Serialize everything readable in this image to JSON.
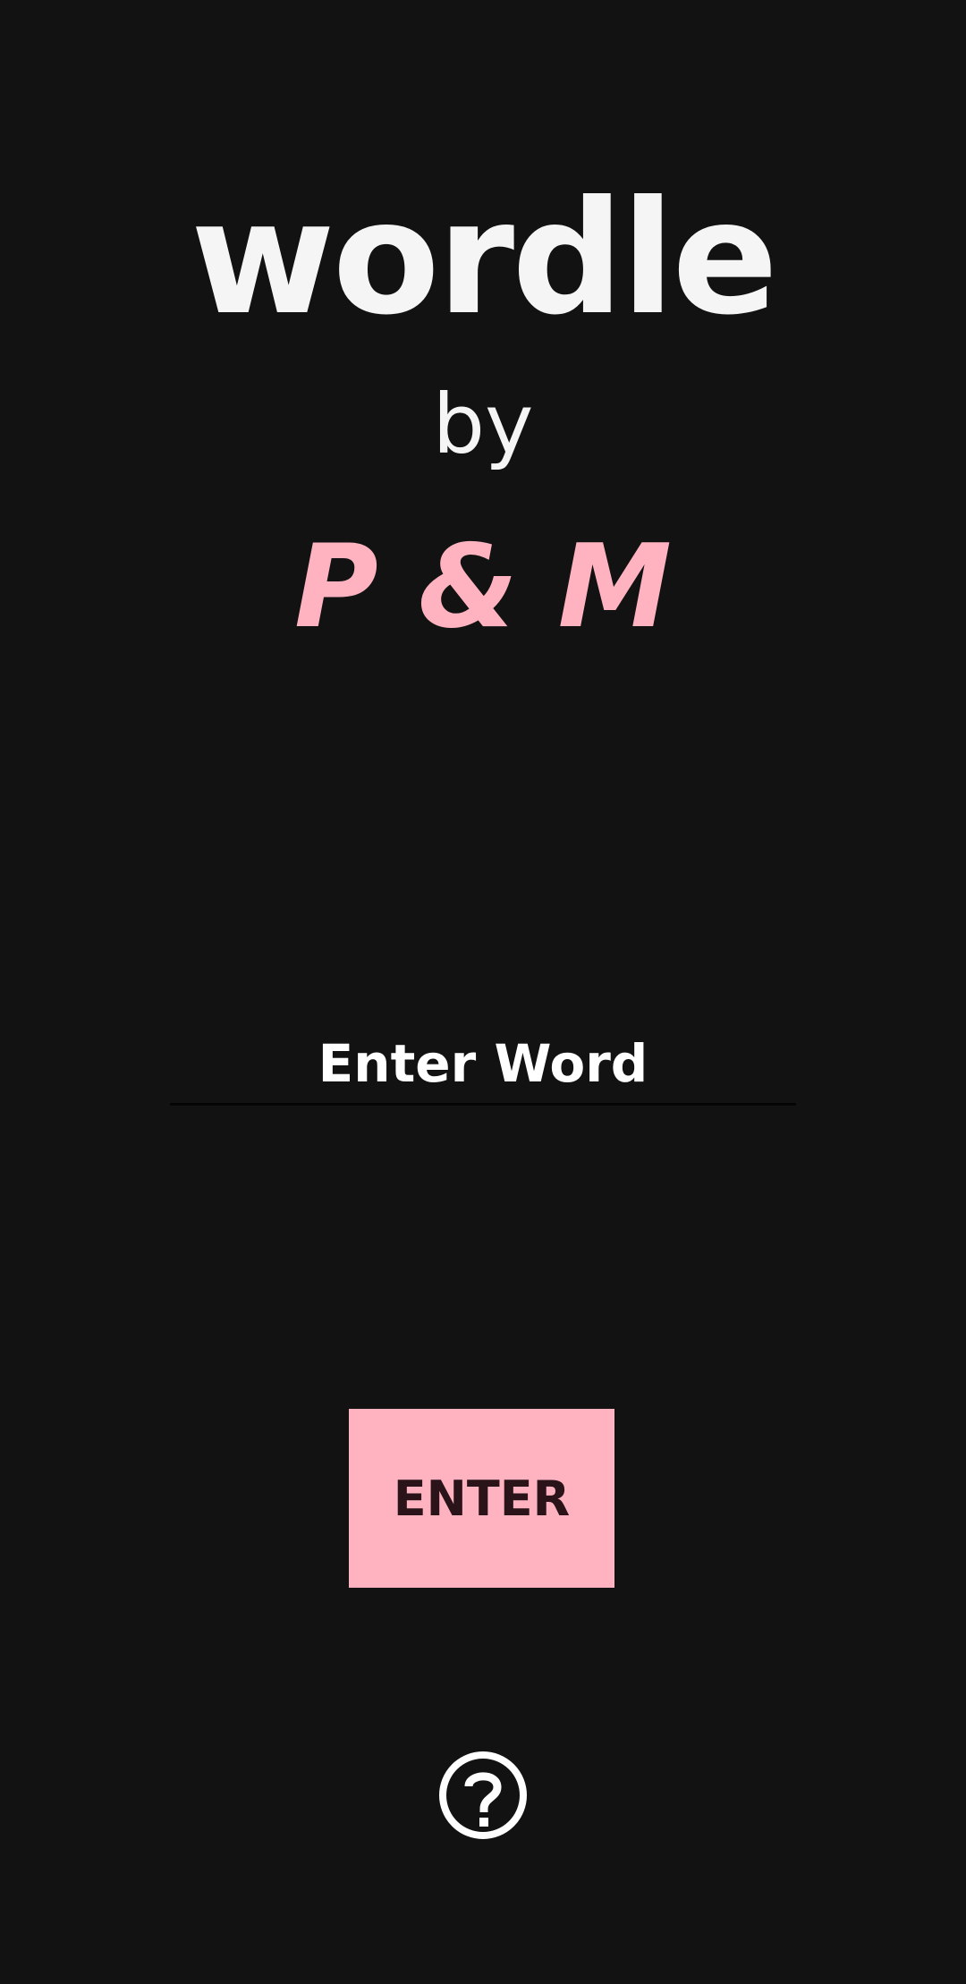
{
  "app": {
    "title": "wordle",
    "by": "by",
    "authors": "P & M"
  },
  "input": {
    "placeholder": "Enter Word",
    "value": ""
  },
  "buttons": {
    "enter_label": "ENTER",
    "help_icon": "help-circle-icon"
  },
  "colors": {
    "background": "#121212",
    "accent": "#ffb3c0",
    "text": "#f5f5f5",
    "button_text": "#2a1419"
  }
}
